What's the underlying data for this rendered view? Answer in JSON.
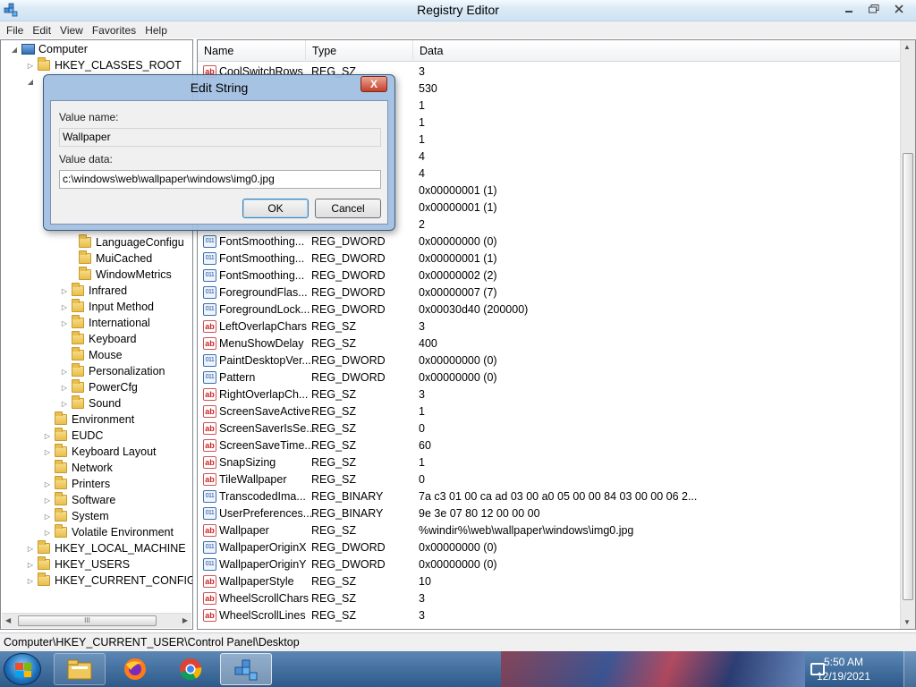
{
  "window": {
    "title": "Registry Editor",
    "controls": [
      "minimize-icon",
      "restore-icon",
      "close-icon"
    ]
  },
  "menu": [
    "File",
    "Edit",
    "View",
    "Favorites",
    "Help"
  ],
  "tree": {
    "root": "Computer",
    "items": [
      {
        "label": "HKEY_CLASSES_ROOT"
      },
      {
        "label": "LanguageConfigu"
      },
      {
        "label": "MuiCached"
      },
      {
        "label": "WindowMetrics"
      },
      {
        "label": "Infrared"
      },
      {
        "label": "Input Method"
      },
      {
        "label": "International"
      },
      {
        "label": "Keyboard"
      },
      {
        "label": "Mouse"
      },
      {
        "label": "Personalization"
      },
      {
        "label": "PowerCfg"
      },
      {
        "label": "Sound"
      },
      {
        "label": "Environment"
      },
      {
        "label": "EUDC"
      },
      {
        "label": "Keyboard Layout"
      },
      {
        "label": "Network"
      },
      {
        "label": "Printers"
      },
      {
        "label": "Software"
      },
      {
        "label": "System"
      },
      {
        "label": "Volatile Environment"
      },
      {
        "label": "HKEY_LOCAL_MACHINE"
      },
      {
        "label": "HKEY_USERS"
      },
      {
        "label": "HKEY_CURRENT_CONFIG"
      }
    ],
    "hscroll_label": "III"
  },
  "list": {
    "columns": [
      "Name",
      "Type",
      "Data"
    ],
    "rows": [
      {
        "name": "CoolSwitchRows",
        "type": "REG_SZ",
        "data": "3",
        "icon": "string-value-icon"
      },
      {
        "name": "",
        "type": "",
        "data": "530",
        "icon": ""
      },
      {
        "name": "",
        "type": "",
        "data": "1",
        "icon": ""
      },
      {
        "name": "",
        "type": "",
        "data": "1",
        "icon": ""
      },
      {
        "name": "",
        "type": "",
        "data": "1",
        "icon": ""
      },
      {
        "name": "",
        "type": "",
        "data": "4",
        "icon": ""
      },
      {
        "name": "",
        "type": "",
        "data": "4",
        "icon": ""
      },
      {
        "name": "",
        "type": "",
        "data": "0x00000001 (1)",
        "icon": ""
      },
      {
        "name": "",
        "type": "",
        "data": "0x00000001 (1)",
        "icon": ""
      },
      {
        "name": "",
        "type": "",
        "data": "2",
        "icon": ""
      },
      {
        "name": "FontSmoothing...",
        "type": "REG_DWORD",
        "data": "0x00000000 (0)",
        "icon": "binary-value-icon"
      },
      {
        "name": "FontSmoothing...",
        "type": "REG_DWORD",
        "data": "0x00000001 (1)",
        "icon": "binary-value-icon"
      },
      {
        "name": "FontSmoothing...",
        "type": "REG_DWORD",
        "data": "0x00000002 (2)",
        "icon": "binary-value-icon"
      },
      {
        "name": "ForegroundFlas...",
        "type": "REG_DWORD",
        "data": "0x00000007 (7)",
        "icon": "binary-value-icon"
      },
      {
        "name": "ForegroundLock...",
        "type": "REG_DWORD",
        "data": "0x00030d40 (200000)",
        "icon": "binary-value-icon"
      },
      {
        "name": "LeftOverlapChars",
        "type": "REG_SZ",
        "data": "3",
        "icon": "string-value-icon"
      },
      {
        "name": "MenuShowDelay",
        "type": "REG_SZ",
        "data": "400",
        "icon": "string-value-icon"
      },
      {
        "name": "PaintDesktopVer...",
        "type": "REG_DWORD",
        "data": "0x00000000 (0)",
        "icon": "binary-value-icon"
      },
      {
        "name": "Pattern",
        "type": "REG_DWORD",
        "data": "0x00000000 (0)",
        "icon": "binary-value-icon"
      },
      {
        "name": "RightOverlapCh...",
        "type": "REG_SZ",
        "data": "3",
        "icon": "string-value-icon"
      },
      {
        "name": "ScreenSaveActive",
        "type": "REG_SZ",
        "data": "1",
        "icon": "string-value-icon"
      },
      {
        "name": "ScreenSaverIsSe...",
        "type": "REG_SZ",
        "data": "0",
        "icon": "string-value-icon"
      },
      {
        "name": "ScreenSaveTime...",
        "type": "REG_SZ",
        "data": "60",
        "icon": "string-value-icon"
      },
      {
        "name": "SnapSizing",
        "type": "REG_SZ",
        "data": "1",
        "icon": "string-value-icon"
      },
      {
        "name": "TileWallpaper",
        "type": "REG_SZ",
        "data": "0",
        "icon": "string-value-icon"
      },
      {
        "name": "TranscodedIma...",
        "type": "REG_BINARY",
        "data": "7a c3 01 00 ca ad 03 00 a0 05 00 00 84 03 00 00 06 2...",
        "icon": "binary-value-icon"
      },
      {
        "name": "UserPreferences...",
        "type": "REG_BINARY",
        "data": "9e 3e 07 80 12 00 00 00",
        "icon": "binary-value-icon"
      },
      {
        "name": "Wallpaper",
        "type": "REG_SZ",
        "data": "%windir%\\web\\wallpaper\\windows\\img0.jpg",
        "icon": "string-value-icon"
      },
      {
        "name": "WallpaperOriginX",
        "type": "REG_DWORD",
        "data": "0x00000000 (0)",
        "icon": "binary-value-icon"
      },
      {
        "name": "WallpaperOriginY",
        "type": "REG_DWORD",
        "data": "0x00000000 (0)",
        "icon": "binary-value-icon"
      },
      {
        "name": "WallpaperStyle",
        "type": "REG_SZ",
        "data": "10",
        "icon": "string-value-icon"
      },
      {
        "name": "WheelScrollChars",
        "type": "REG_SZ",
        "data": "3",
        "icon": "string-value-icon"
      },
      {
        "name": "WheelScrollLines",
        "type": "REG_SZ",
        "data": "3",
        "icon": "string-value-icon"
      }
    ]
  },
  "status": "Computer\\HKEY_CURRENT_USER\\Control Panel\\Desktop",
  "dialog": {
    "title": "Edit String",
    "value_name_label": "Value name:",
    "value_name": "Wallpaper",
    "value_data_label": "Value data:",
    "value_data": "c:\\windows\\web\\wallpaper\\windows\\img0.jpg",
    "ok_label": "OK",
    "cancel_label": "Cancel",
    "close_glyph": "X"
  },
  "taskbar": {
    "items": [
      "file-explorer-icon",
      "firefox-icon",
      "chrome-icon",
      "registry-editor-icon"
    ],
    "time": "5:50 AM",
    "date": "12/19/2021"
  },
  "colors": {
    "accent": "#3c7fb1",
    "taskbar": "#2d5a8a",
    "dialog_frame": "#a0bee1"
  }
}
